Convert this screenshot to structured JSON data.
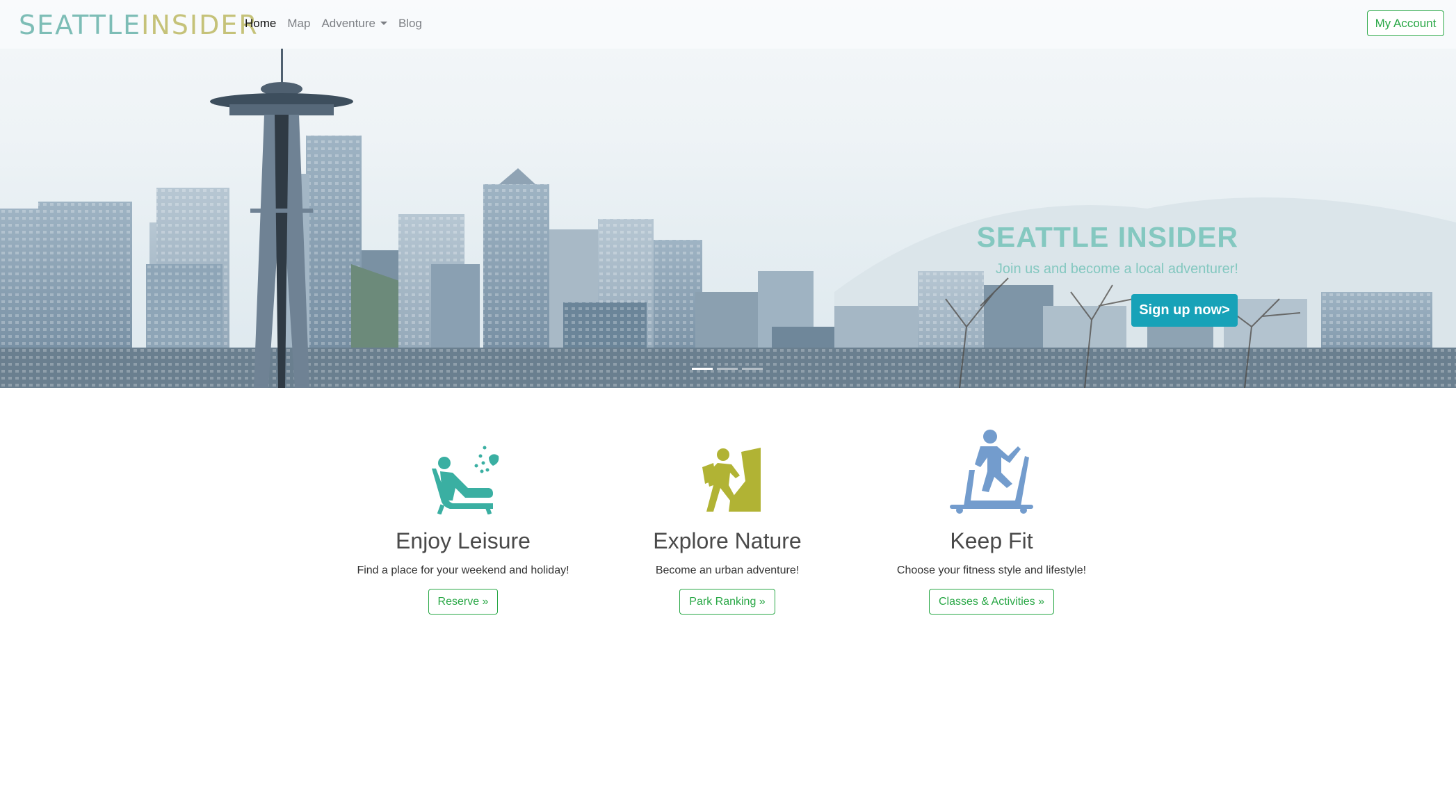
{
  "nav": {
    "brand_part1": "SEATTLE",
    "brand_part2": "INSIDER",
    "links": [
      "Home",
      "Map",
      "Adventure",
      "Blog"
    ],
    "account_button": "My Account"
  },
  "hero": {
    "title": "SEATTLE INSIDER",
    "subtitle": "Join us and become a local adventurer!",
    "cta": "Sign up now>",
    "slides": 3,
    "active_slide": 1
  },
  "features": [
    {
      "icon": "lounge-chair-icon",
      "title": "Enjoy Leisure",
      "text": "Find a place for your weekend and holiday!",
      "button": "Reserve »",
      "color": "#3aafa2"
    },
    {
      "icon": "hiker-icon",
      "title": "Explore Nature",
      "text": "Become an urban adventure!",
      "button": "Park Ranking »",
      "color": "#b1b334"
    },
    {
      "icon": "treadmill-icon",
      "title": "Keep Fit",
      "text": "Choose your fitness style and lifestyle!",
      "button": "Classes & Activities »",
      "color": "#739ccd"
    }
  ],
  "colors": {
    "brand_teal": "#7dbdb6",
    "brand_olive": "#c5c279",
    "cta": "#17a2b8",
    "outline_green": "#28a745"
  }
}
